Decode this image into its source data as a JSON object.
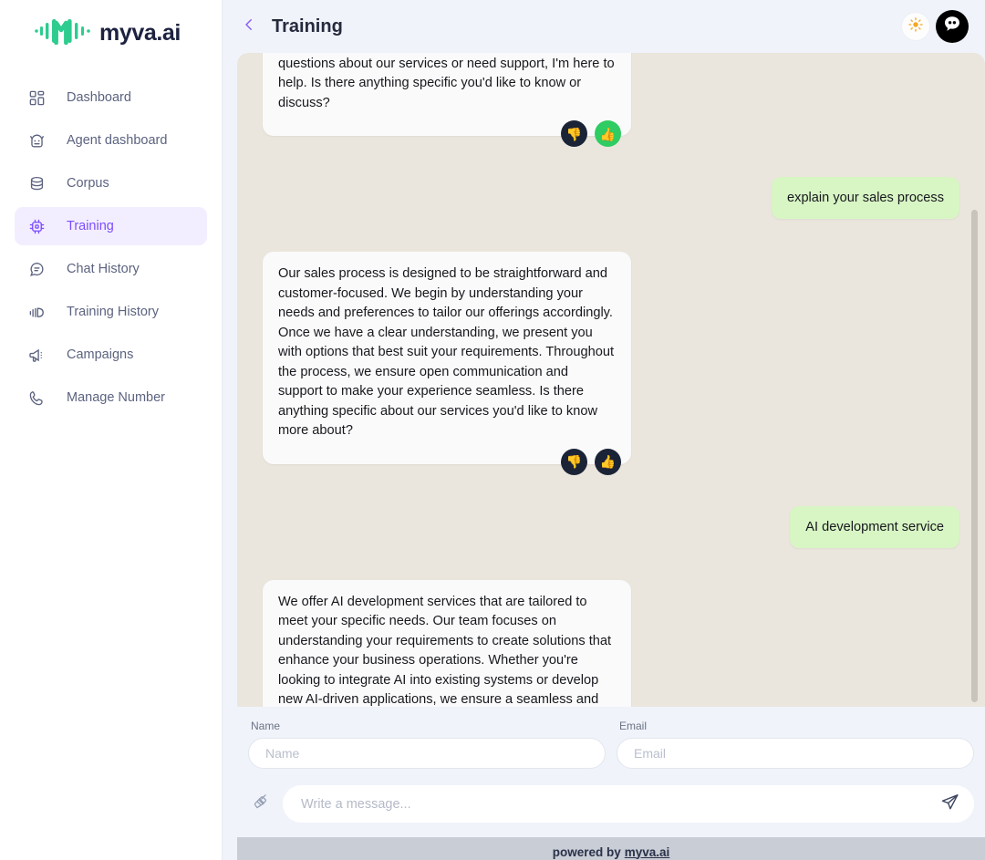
{
  "brand": {
    "name": "myva.ai",
    "logo_icon": "waveform-m-logo",
    "accent_green": "#2ecc62",
    "accent_purple": "#7c4dff",
    "text_navy": "#1d2240"
  },
  "sidebar": {
    "items": [
      {
        "label": "Dashboard",
        "icon": "grid-dashboard-icon",
        "active": false
      },
      {
        "label": "Agent dashboard",
        "icon": "robot-head-icon",
        "active": false
      },
      {
        "label": "Corpus",
        "icon": "database-icon",
        "active": false
      },
      {
        "label": "Training",
        "icon": "chip-cpu-icon",
        "active": true
      },
      {
        "label": "Chat History",
        "icon": "chat-bubble-icon",
        "active": false
      },
      {
        "label": "Training History",
        "icon": "bar-wave-icon",
        "active": false
      },
      {
        "label": "Campaigns",
        "icon": "megaphone-icon",
        "active": false
      },
      {
        "label": "Manage Number",
        "icon": "phone-icon",
        "active": false
      }
    ]
  },
  "header": {
    "back_icon": "chevron-left-icon",
    "title": "Training",
    "theme_toggle_icon": "sun-icon",
    "avatar_icon": "bot-avatar-icon"
  },
  "chat": {
    "messages": [
      {
        "role": "bot",
        "text": "Hello! How can I assist you today? Whether you have questions about our services or need support, I'm here to help. Is there anything specific you'd like to know or discuss?",
        "feedback": {
          "dislike_icon": "thumbs-down-icon",
          "like_icon": "thumbs-up-icon",
          "liked": true
        }
      },
      {
        "role": "user",
        "text": "explain your sales process"
      },
      {
        "role": "bot",
        "text": "Our sales process is designed to be straightforward and customer-focused. We begin by understanding your needs and preferences to tailor our offerings accordingly. Once we have a clear understanding, we present you with options that best suit your requirements. Throughout the process, we ensure open communication and support to make your experience seamless. Is there anything specific about our services you'd like to know more about?",
        "feedback": {
          "dislike_icon": "thumbs-down-icon",
          "like_icon": "thumbs-up-icon",
          "liked": false
        }
      },
      {
        "role": "user",
        "text": "AI development service"
      },
      {
        "role": "bot",
        "text": "We offer AI development services that are tailored to meet your specific needs. Our team focuses on understanding your requirements to create solutions that enhance your business operations. Whether you're looking to integrate AI into existing systems or develop new AI-driven applications, we ensure a seamless and effective implementation. If you'd like us to keep you informed about the outcome, could you please share your contact details?",
        "feedback": {
          "dislike_icon": "thumbs-down-icon",
          "like_icon": "thumbs-up-icon",
          "liked": false
        }
      }
    ]
  },
  "form": {
    "name_label": "Name",
    "name_placeholder": "Name",
    "name_value": "",
    "email_label": "Email",
    "email_placeholder": "Email",
    "email_value": "",
    "clear_icon": "broom-icon",
    "message_placeholder": "Write a message...",
    "message_value": "",
    "send_icon": "send-paper-plane-icon"
  },
  "footer": {
    "powered_prefix": "powered by",
    "powered_link": "myva.ai"
  }
}
